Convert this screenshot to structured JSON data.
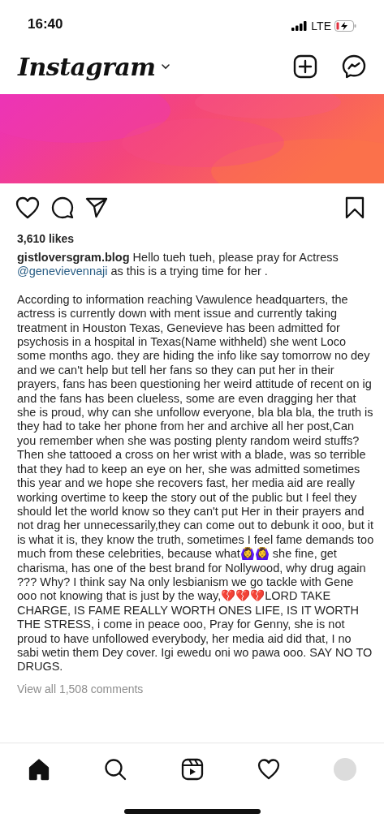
{
  "status_bar": {
    "time": "16:40",
    "network": "LTE"
  },
  "header": {
    "logo": "Instagram"
  },
  "post": {
    "actions": {
      "liked": false,
      "saved": false
    },
    "likes": "3,610 likes",
    "caption": {
      "before": "**gistloversgram.blog** Hello tueh tueh, please pray for Actress ",
      "mention": "@genevievennaji",
      "after": " as this is a trying time for her ."
    },
    "body": "According to information reaching Vawulence headquarters, the actress is currently down with ment issue and currently taking treatment in Houston Texas, Genevieve has been admitted for psychosis in a hospital in Texas(Name withheld) she went Loco some months ago. they are hiding the info like say tomorrow no dey and we can't help but tell her fans so they can put her in their prayers, fans has been questioning her weird attitude of recent on ig and the fans has been clueless, some are even dragging her that she is proud, why can she unfollow everyone, bla bla bla, the truth is they had to take her phone from her and archive all her post,Can you remember when she was posting plenty random weird stuffs? Then she tattooed a cross on her wrist with a blade, was so terrible that they had to keep an eye on her, she was admitted sometimes this year and we hope she recovers fast, her media aid are really working overtime to keep the story out of the public but I feel they should let the world know so they can't put Her in their prayers and not drag her unnecessarily,they can come out to debunk it ooo, but it is what it is, they know the truth, sometimes I feel fame demands too much from these celebrities, because what🙆‍♀️🙆‍♀️ she fine, get charisma, has one of the best brand for Nollywood, why drug again ??? Why? I think say Na only lesbianism we go tackle with Gene ooo not knowing that is just by the way,💔💔💔LORD TAKE CHARGE, IS FAME REALLY WORTH ONES LIFE, IS IT WORTH THE STRESS, i come in peace ooo, Pray for Genny, she is not proud to have unfollowed everybody, her media aid did that, I no sabi wetin them Dey cover. Igi ewedu oni wo pawa ooo. SAY NO TO DRUGS.",
    "comments": "View all 1,508 comments"
  },
  "tab_bar": [
    {
      "kind": "home",
      "selected": true
    },
    {
      "kind": "search",
      "selected": false
    },
    {
      "kind": "reels",
      "selected": false
    },
    {
      "kind": "activity",
      "selected": false
    },
    {
      "kind": "profile",
      "selected": false
    }
  ]
}
